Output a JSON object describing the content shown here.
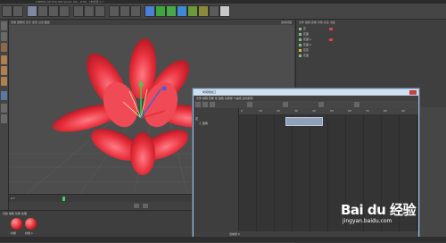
{
  "window": {
    "title": "CINEMA 4D R16.050 Studio (RC - R16) - [未标题 1] *"
  },
  "viewport": {
    "menu_left": "查看 摄像机 显示 选项 过滤 面板",
    "label_right": "透视视图"
  },
  "object_manager": {
    "menu": "文件 编辑 查看 对象 标签 书签",
    "rows": [
      {
        "label": "花"
      },
      {
        "label": "花瓣"
      },
      {
        "label": "花瓣.1"
      },
      {
        "label": "花瓣.2"
      },
      {
        "label": "花蕊"
      },
      {
        "label": "花茎"
      }
    ]
  },
  "dopesheet": {
    "title": "时间线窗口",
    "menu": "文件 编辑 查看 帧 函数 关键帧 F-曲线 运动剪辑",
    "tracks": [
      {
        "label": "花"
      },
      {
        "label": "ⓘ 变换"
      }
    ],
    "ruler_labels": [
      "0",
      "10",
      "20",
      "30",
      "40",
      "50",
      "60",
      "70",
      "80",
      "90"
    ],
    "status": "当前帧 0"
  },
  "timeline": {
    "start": "0 F",
    "end": "90 F"
  },
  "material_bar": {
    "menu": "创建 编辑 功能 纹理",
    "items": [
      "材质",
      "材质.1"
    ]
  },
  "watermark": {
    "brand": "Bai du 经验",
    "url": "jingyan.baidu.com"
  },
  "colors": {
    "flower": "#e8303c",
    "accent": "#cfdff0"
  }
}
